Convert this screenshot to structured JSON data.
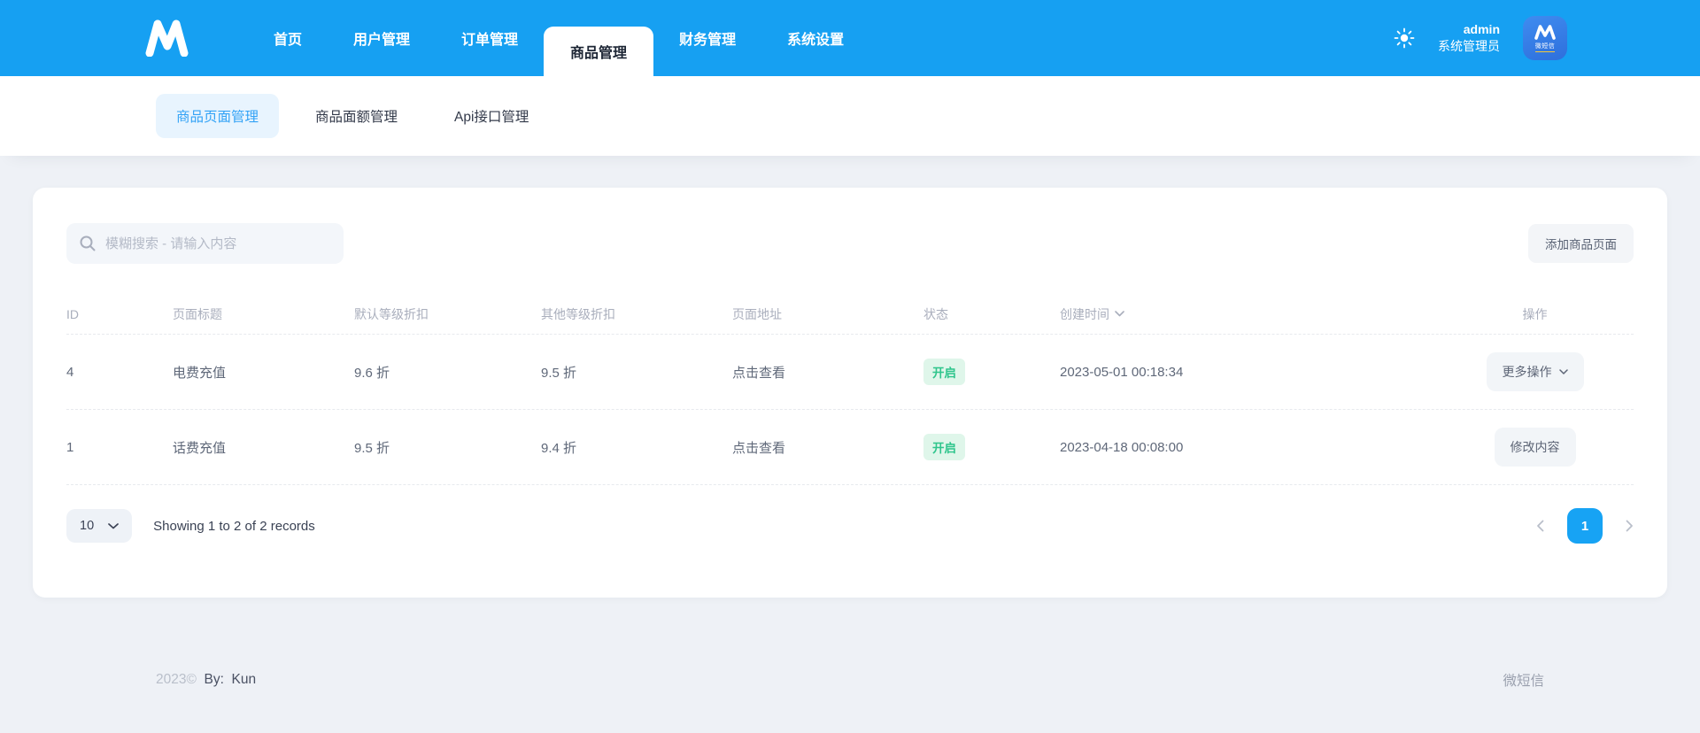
{
  "header": {
    "nav": [
      {
        "label": "首页",
        "active": false
      },
      {
        "label": "用户管理",
        "active": false
      },
      {
        "label": "订单管理",
        "active": false
      },
      {
        "label": "商品管理",
        "active": true
      },
      {
        "label": "财务管理",
        "active": false
      },
      {
        "label": "系统设置",
        "active": false
      }
    ],
    "user": {
      "name": "admin",
      "role": "系统管理员"
    },
    "avatar_caption": "微短信"
  },
  "subnav": [
    {
      "label": "商品页面管理",
      "active": true
    },
    {
      "label": "商品面额管理",
      "active": false
    },
    {
      "label": "Api接口管理",
      "active": false
    }
  ],
  "toolbar": {
    "search_placeholder": "模糊搜索 - 请输入内容",
    "add_button": "添加商品页面"
  },
  "table": {
    "columns": {
      "id": "ID",
      "title": "页面标题",
      "default_discount": "默认等级折扣",
      "other_discount": "其他等级折扣",
      "page_link": "页面地址",
      "status": "状态",
      "created": "创建时间",
      "actions": "操作"
    },
    "rows": [
      {
        "id": "4",
        "title": "电费充值",
        "default_discount": "9.6 折",
        "other_discount": "9.5 折",
        "page_link": "点击查看",
        "status": "开启",
        "created": "2023-05-01 00:18:34",
        "action": "更多操作"
      },
      {
        "id": "1",
        "title": "话费充值",
        "default_discount": "9.5 折",
        "other_discount": "9.4 折",
        "page_link": "点击查看",
        "status": "开启",
        "created": "2023-04-18 00:08:00",
        "action": "修改内容"
      }
    ]
  },
  "pagination": {
    "page_size": "10",
    "summary": "Showing 1 to 2 of 2 records",
    "current_page": "1"
  },
  "footer": {
    "year": "2023©",
    "by": "By:  Kun",
    "right": "微短信"
  },
  "colors": {
    "header_blue": "#16a0f2",
    "accent_blue": "#17a3f4",
    "active_pill_bg": "#e8f4fe",
    "active_pill_text": "#34a3f6",
    "status_green_text": "#2ec58c",
    "status_green_bg": "#dff6ea",
    "page_bg": "#eef1f6"
  }
}
